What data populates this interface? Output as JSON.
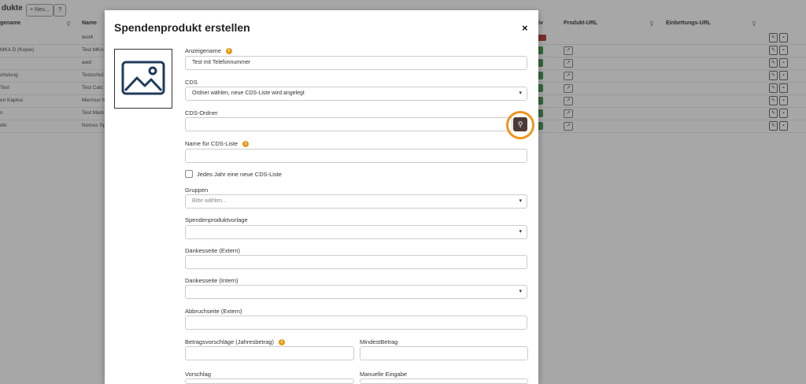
{
  "background": {
    "title": "dukte",
    "new_button": "+ Neu...",
    "help_button": "?",
    "columns": {
      "anzeigename": "gename",
      "name": "Name",
      "aktiv": "iv",
      "produkt_url": "Produkt-URL",
      "einbettungs_url": "Einbettungs-URL"
    },
    "rows": [
      {
        "anzeigename": "",
        "name": "test4",
        "status": "red"
      },
      {
        "anzeigename": "MKA D (Kopie)",
        "name": "Test MKA",
        "status": "green"
      },
      {
        "anzeigename": "",
        "name": "awd",
        "status": "green"
      },
      {
        "anzeigename": "chulung",
        "name": "Testschul",
        "status": "green"
      },
      {
        "anzeigename": "Test",
        "name": "Test Catc",
        "status": "green"
      },
      {
        "anzeigename": "en Kaptus",
        "name": "Mermus N",
        "status": "green"
      },
      {
        "anzeigename": "n",
        "name": "Test Mark",
        "status": "green"
      },
      {
        "anzeigename": "din",
        "name": "Nomos Sp",
        "status": "green"
      }
    ]
  },
  "modal": {
    "title": "Spendenprodukt erstellen",
    "close": "×",
    "image_placeholder_icon": "image-icon",
    "fields": {
      "anzeigename_label": "Anzeigename",
      "anzeigename_value": "Test mit Telefonnummer",
      "cds_label": "CDS",
      "cds_value": "Ordner wählen, neue CDS-Liste wird angelegt",
      "cds_ordner_label": "CDS-Ordner",
      "cds_ordner_value": "",
      "name_cds_liste_label": "Name für CDS-Liste",
      "name_cds_liste_value": "",
      "jedes_jahr_label": "Jedes Jahr eine neue CDS-Liste",
      "gruppen_label": "Gruppen",
      "gruppen_placeholder": "Bitte wählen...",
      "vorlage_label": "Spendenproduktvorlage",
      "dankesseite_extern_label": "Dankesseite (Extern)",
      "dankesseite_intern_label": "Dankesseite (Intern)",
      "abbruchseite_label": "Abbruchseite (Extern)",
      "betragsvorschlaege_label": "Betragsvorschläge (Jahresbetrag)",
      "mindestbetrag_label": "MindestBetrag",
      "vorschlag_label": "Vorschlag",
      "manuelle_eingabe_label": "Manuelle Eingabe"
    },
    "info_icon": "i",
    "dropdown_arrow": "▾"
  },
  "colors": {
    "accent_ring": "#f0951c",
    "info": "#e59a1a",
    "search_button": "#4a3b37",
    "active_green": "#2e8b3e",
    "inactive_red": "#b02020"
  }
}
